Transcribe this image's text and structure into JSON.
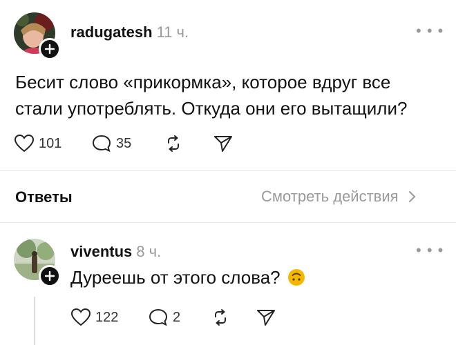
{
  "post": {
    "username": "radugatesh",
    "time": "11 ч.",
    "text_line1": "Бесит слово «прикормка», которое вдруг все",
    "text_line2": "стали употреблять. Откуда они его вытащили?",
    "likes": "101",
    "comments": "35"
  },
  "answers": {
    "title": "Ответы",
    "view_label": "Смотреть действия"
  },
  "reply": {
    "username": "viventus",
    "time": "8 ч.",
    "text": "Дуреешь от этого слова?",
    "emoji": "🙃",
    "likes": "122",
    "comments": "2"
  },
  "icons": {
    "more": "more-dots-icon",
    "like": "heart-icon",
    "comment": "comment-icon",
    "repost": "repost-icon",
    "share": "send-icon",
    "follow": "plus-icon",
    "chevron": "chevron-right-icon"
  },
  "colors": {
    "text": "#111111",
    "muted": "#9a9a9a",
    "divider": "#e6e6e6",
    "emoji": "#f5b800"
  }
}
